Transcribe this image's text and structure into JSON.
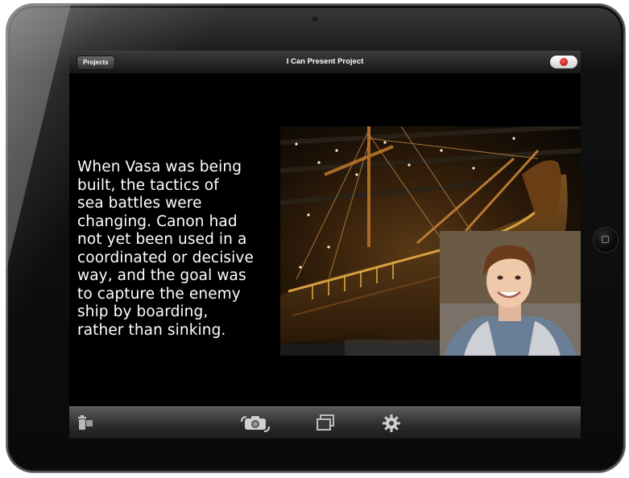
{
  "app": {
    "title": "I Can Present Project",
    "projects_label": "Projects"
  },
  "slide": {
    "lines": [
      "When Vasa was being",
      "built, the tactics of",
      "sea battles were",
      "changing. Canon had",
      "not yet been used in a",
      "coordinated or decisive",
      "way, and the goal was",
      "to capture the enemy",
      "ship by boarding,",
      "rather than sinking."
    ]
  },
  "toolbar": {
    "icons": [
      "trash-icon",
      "camera-switch-icon",
      "slides-icon",
      "gear-icon"
    ]
  },
  "colors": {
    "record": "#cc0000",
    "screen_bg": "#000000",
    "text": "#ffffff"
  }
}
